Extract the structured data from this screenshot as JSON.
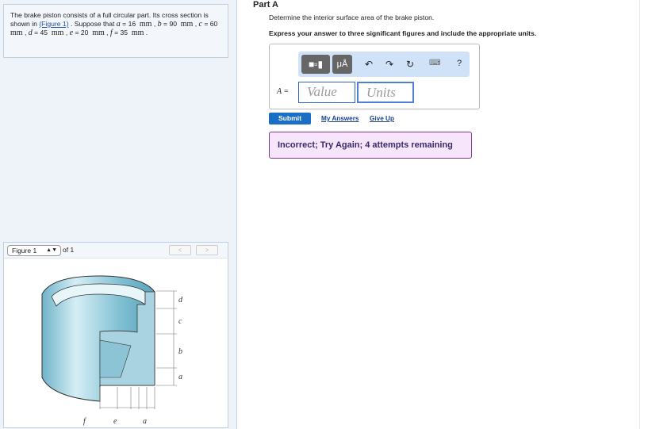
{
  "problem": {
    "text1": "The brake piston consists of a full circular part. Its cross section is shown in ",
    "figure_link": "(Figure 1)",
    "text2": " . Suppose that ",
    "vars": [
      {
        "sym": "a",
        "val": "16",
        "unit": "mm"
      },
      {
        "sym": "b",
        "val": "90",
        "unit": "mm"
      },
      {
        "sym": "c",
        "val": "60",
        "unit": "mm"
      },
      {
        "sym": "d",
        "val": "45",
        "unit": "mm"
      },
      {
        "sym": "e",
        "val": "20",
        "unit": "mm"
      },
      {
        "sym": "f",
        "val": "35",
        "unit": "mm"
      }
    ]
  },
  "figure": {
    "select": "Figure 1",
    "of": "of 1",
    "prev": "<",
    "next": ">",
    "labels": {
      "d": "d",
      "c": "c",
      "b": "b",
      "a": "a",
      "f": "f",
      "e": "e",
      "a2": "a"
    }
  },
  "part": {
    "title": "Part A",
    "question": "Determine the interior surface area of the brake piston.",
    "instructions": "Express your answer to three significant figures and include the appropriate units."
  },
  "answer": {
    "label": "A =",
    "value_placeholder": "Value",
    "units_placeholder": "Units",
    "toolbar": {
      "mu": "μÅ",
      "help": "?"
    }
  },
  "actions": {
    "submit": "Submit",
    "my_answers": "My Answers",
    "give_up": "Give Up"
  },
  "feedback": "Incorrect; Try Again; 4 attempts remaining"
}
